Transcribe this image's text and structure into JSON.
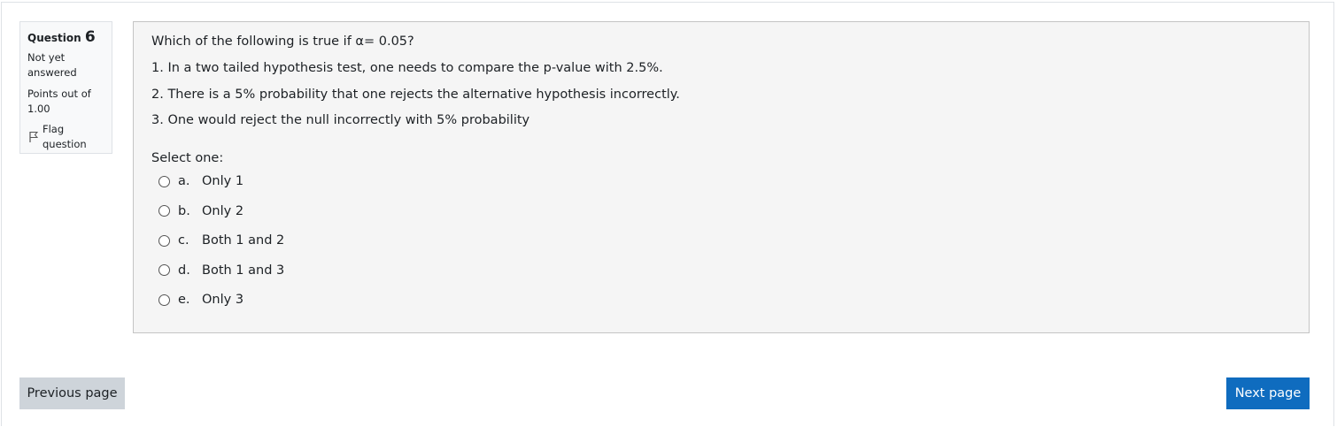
{
  "question_info": {
    "label": "Question",
    "number": "6",
    "state": "Not yet answered",
    "grade": "Points out of 1.00",
    "flag_label": "Flag question"
  },
  "question": {
    "text": "Which of the following is true if α= 0.05?",
    "statements": [
      "1. In a two tailed hypothesis test, one needs to compare the p-value with 2.5%.",
      "2. There is a 5% probability that one rejects the alternative hypothesis incorrectly.",
      "3. One would reject the null incorrectly with 5% probability"
    ],
    "prompt": "Select one:",
    "options": [
      {
        "letter": "a.",
        "text": "Only 1"
      },
      {
        "letter": "b.",
        "text": "Only 2"
      },
      {
        "letter": "c.",
        "text": "Both 1 and 2"
      },
      {
        "letter": "d.",
        "text": "Both 1 and 3"
      },
      {
        "letter": "e.",
        "text": "Only 3"
      }
    ]
  },
  "navigation": {
    "previous_label": "Previous page",
    "next_label": "Next page"
  },
  "icons": {
    "flag": "flag-icon"
  },
  "colors": {
    "primary": "#0f6cbf",
    "secondary": "#ced4da",
    "content_bg": "#f5f5f5",
    "info_bg": "#f8f9fa"
  }
}
